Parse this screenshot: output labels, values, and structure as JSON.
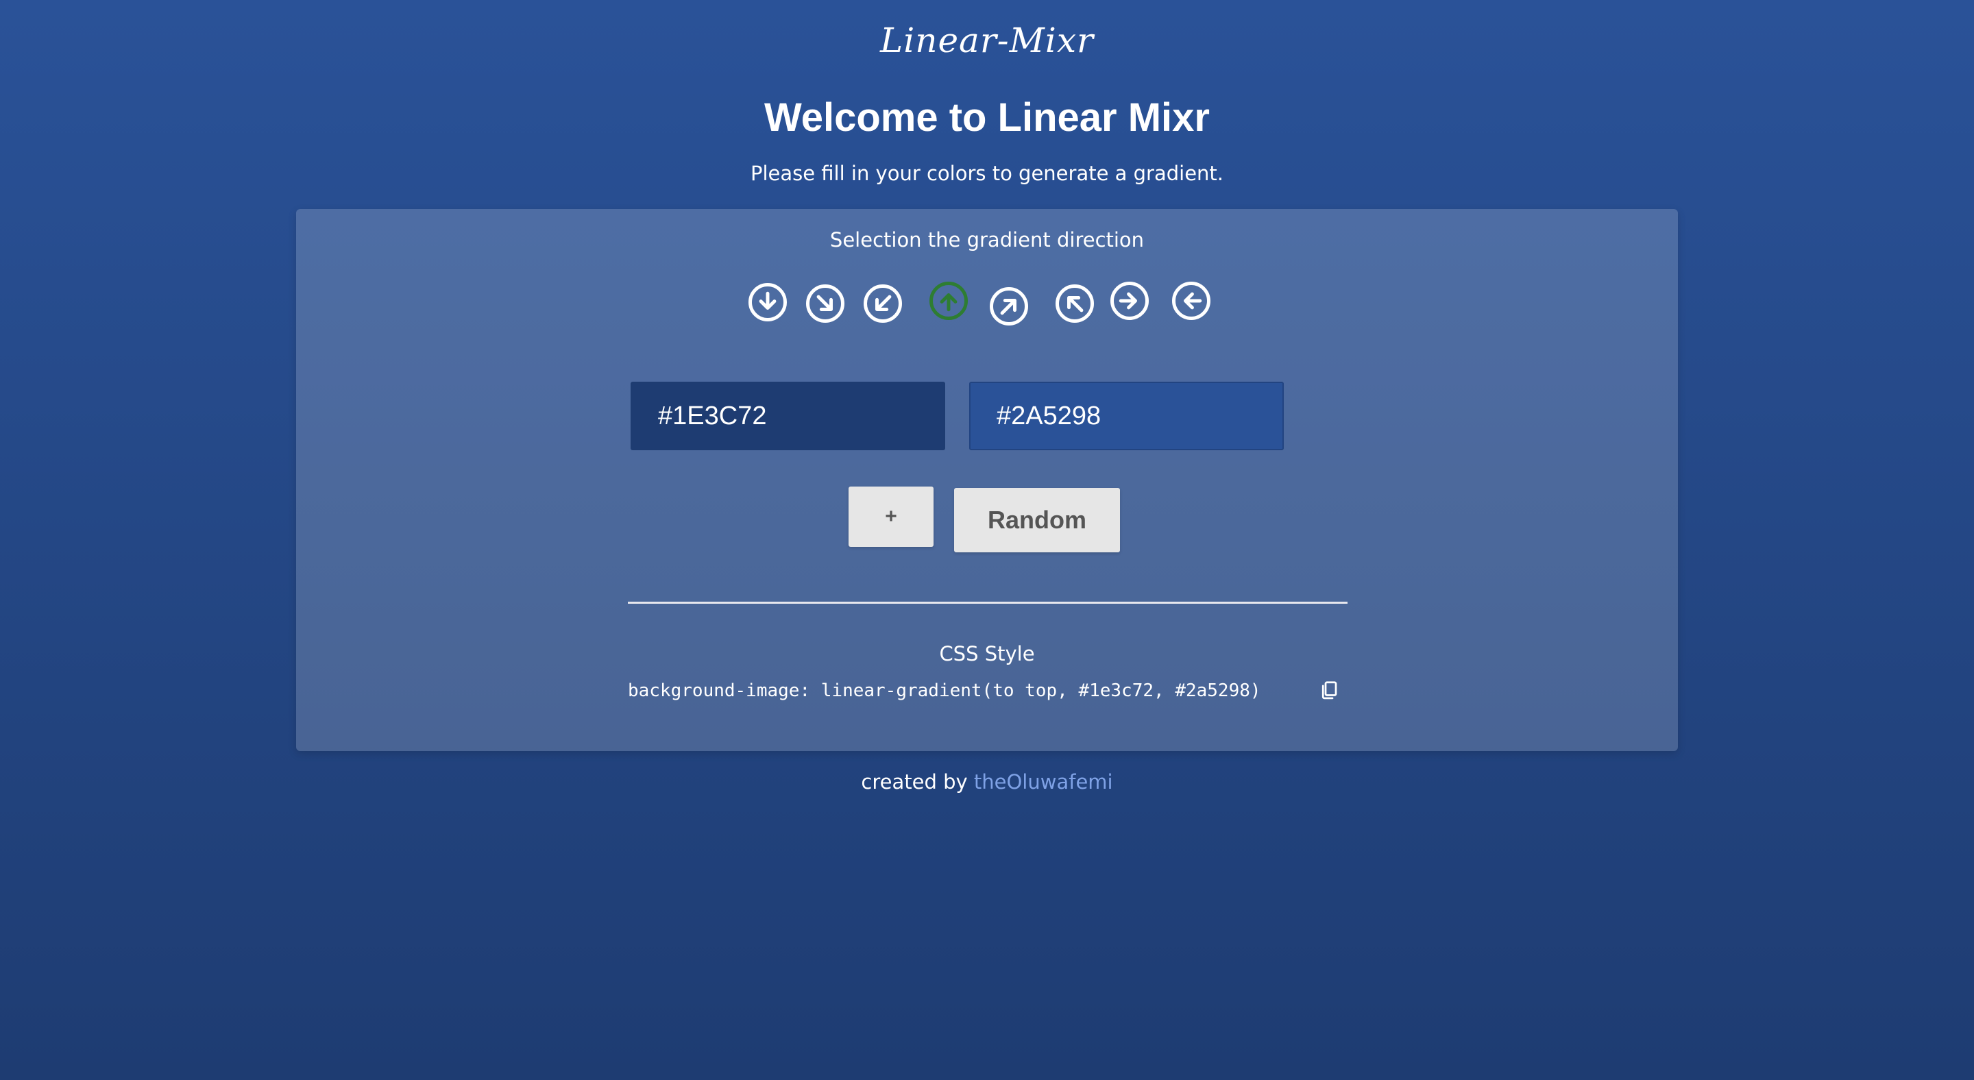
{
  "header": {
    "logo": "Linear-Mixr",
    "title": "Welcome to Linear Mixr",
    "subtitle": "Please fill in your colors to generate a gradient."
  },
  "card": {
    "direction_label": "Selection the gradient direction",
    "directions": [
      {
        "name": "to bottom",
        "icon": "arrow-down-circle-icon"
      },
      {
        "name": "to bottom right",
        "icon": "arrow-down-right-circle-icon"
      },
      {
        "name": "to bottom left",
        "icon": "arrow-down-left-circle-icon"
      },
      {
        "name": "to top",
        "icon": "arrow-up-circle-icon",
        "active": true
      },
      {
        "name": "to top right",
        "icon": "arrow-up-right-circle-icon"
      },
      {
        "name": "to top left",
        "icon": "arrow-up-left-circle-icon"
      },
      {
        "name": "to right",
        "icon": "arrow-right-circle-icon"
      },
      {
        "name": "to left",
        "icon": "arrow-left-circle-icon"
      }
    ],
    "color1": "#1E3C72",
    "color2": "#2A5298",
    "add_label": "+",
    "random_label": "Random",
    "css_label": "CSS Style",
    "css_code": "background-image: linear-gradient(to top, #1e3c72, #2a5298)"
  },
  "footer": {
    "prefix": "created by",
    "author": "theOluwafemi"
  },
  "colors": {
    "gradient_start": "#1e3c72",
    "gradient_end": "#2a5298",
    "active_direction": "#2e7d32",
    "link": "#7fa2e6"
  }
}
